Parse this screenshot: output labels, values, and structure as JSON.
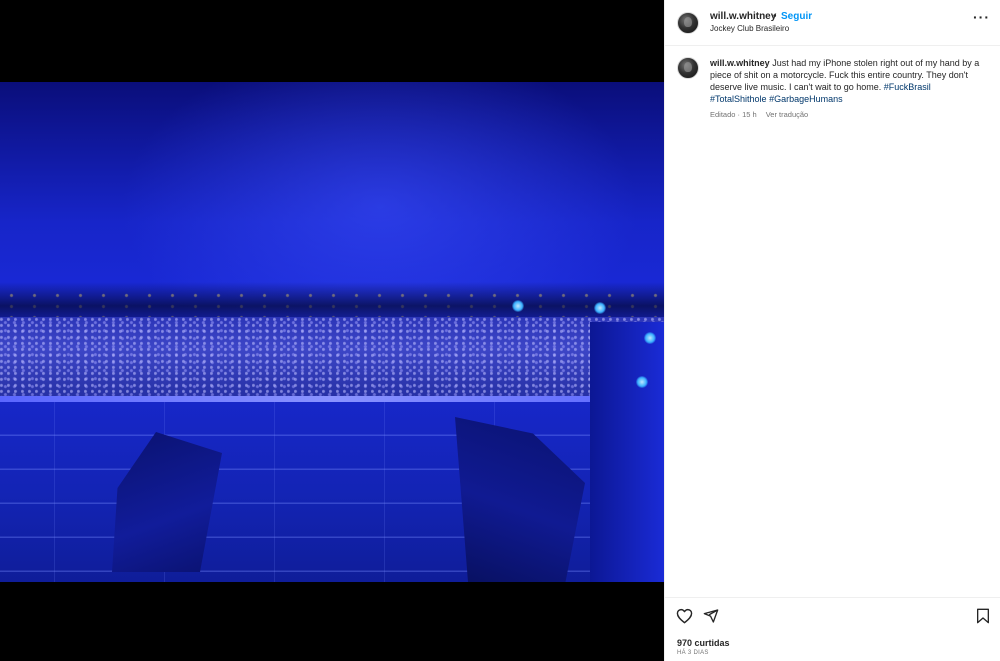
{
  "post": {
    "username": "will.w.whitney",
    "separator": "•",
    "follow_label": "Seguir",
    "location": "Jockey Club Brasileiro",
    "more_icon": "more-horizontal-icon"
  },
  "caption": {
    "username": "will.w.whitney",
    "text": " Just had my iPhone stolen right out of my hand by a piece of shit on a motorcycle. Fuck this entire country. They don't deserve live music. I can't wait to go home. ",
    "hashtags": [
      "#FuckBrasil",
      "#TotalShithole",
      "#GarbageHumans"
    ],
    "edited_label": "Editado · 15 h",
    "translate_label": "Ver tradução"
  },
  "actions": {
    "like_icon": "heart-icon",
    "share_icon": "send-icon",
    "save_icon": "bookmark-icon",
    "likes": "970 curtidas",
    "posted_ago": "HÁ 3 DIAS"
  },
  "colors": {
    "link_blue": "#0095f6",
    "hashtag_blue": "#00376b",
    "stage_blue": "#1a2ad9"
  }
}
